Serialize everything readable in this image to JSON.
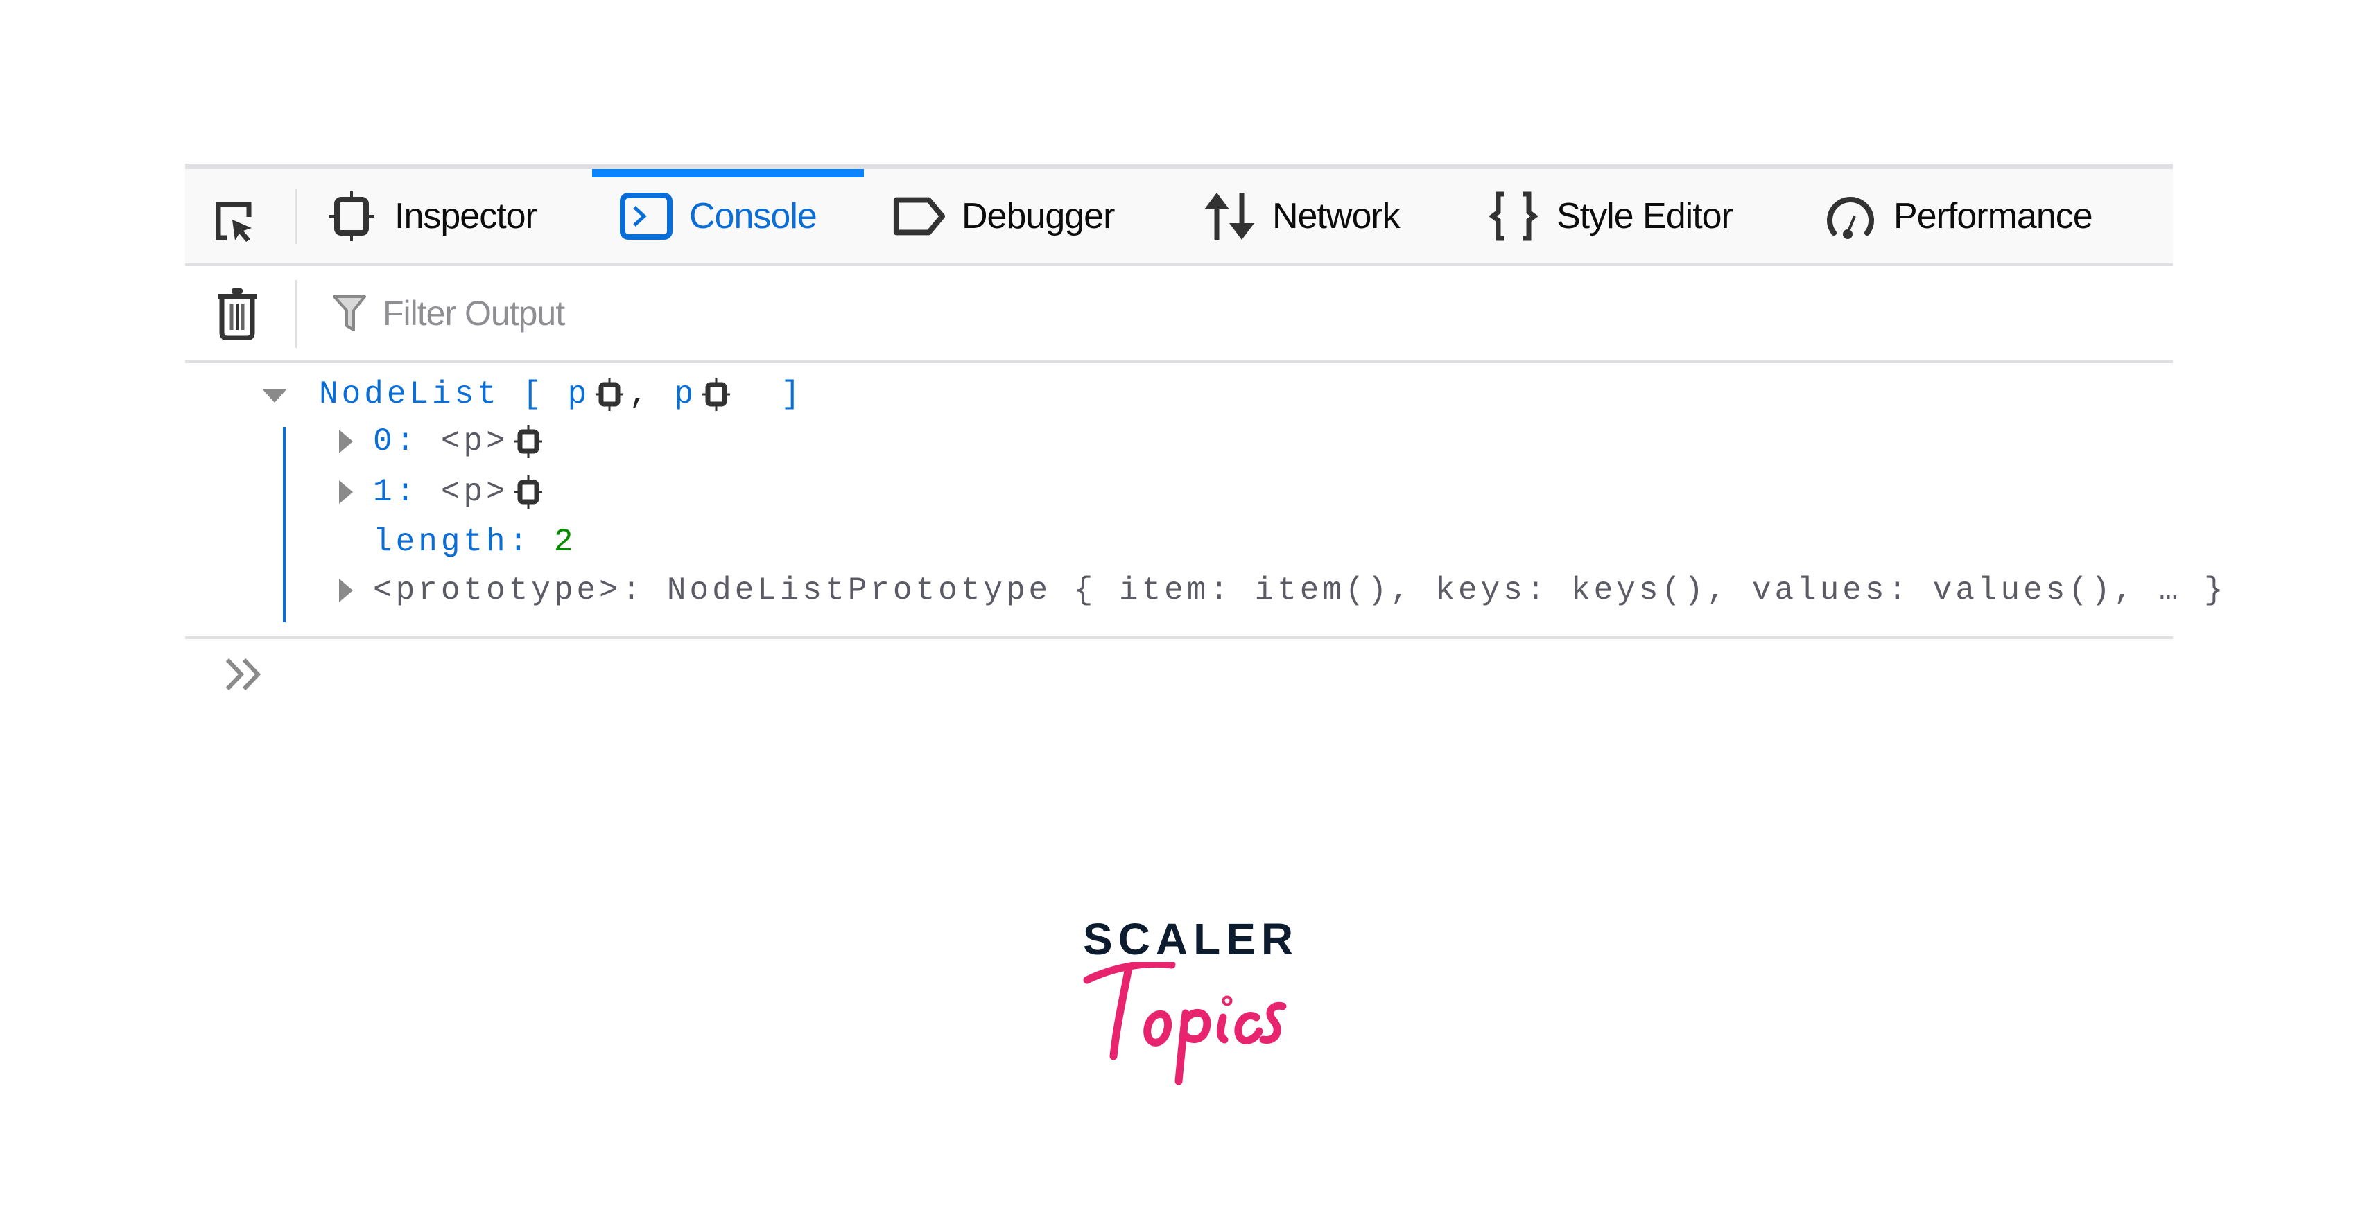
{
  "devtools": {
    "tabs": [
      {
        "id": "inspector",
        "label": "Inspector",
        "icon": "inspector-icon",
        "active": false
      },
      {
        "id": "console",
        "label": "Console",
        "icon": "console-icon",
        "active": true
      },
      {
        "id": "debugger",
        "label": "Debugger",
        "icon": "debugger-icon",
        "active": false
      },
      {
        "id": "network",
        "label": "Network",
        "icon": "network-arrows-icon",
        "active": false
      },
      {
        "id": "style-editor",
        "label": "Style Editor",
        "icon": "braces-icon",
        "active": false
      },
      {
        "id": "performance",
        "label": "Performance",
        "icon": "gauge-icon",
        "active": false
      }
    ],
    "accent_color": "#0a84ff",
    "filter": {
      "placeholder": "Filter Output",
      "value": ""
    },
    "console": {
      "nodelist": {
        "label": "NodeList",
        "open_bracket": "[",
        "item_a": "p",
        "comma": ",",
        "item_b": "p",
        "close_bracket": "]"
      },
      "entries": [
        {
          "key": "0:",
          "value": "<p>"
        },
        {
          "key": "1:",
          "value": "<p>"
        }
      ],
      "length": {
        "key": "length:",
        "value": "2"
      },
      "prototype": {
        "key": "<prototype>:",
        "value": "NodeListPrototype { item: item(), keys: keys(), values: values(), … }"
      }
    }
  },
  "branding": {
    "line1": "SCALER",
    "line2": "Topics",
    "primary_color": "#0d1b2e",
    "accent_color": "#e8246f"
  }
}
